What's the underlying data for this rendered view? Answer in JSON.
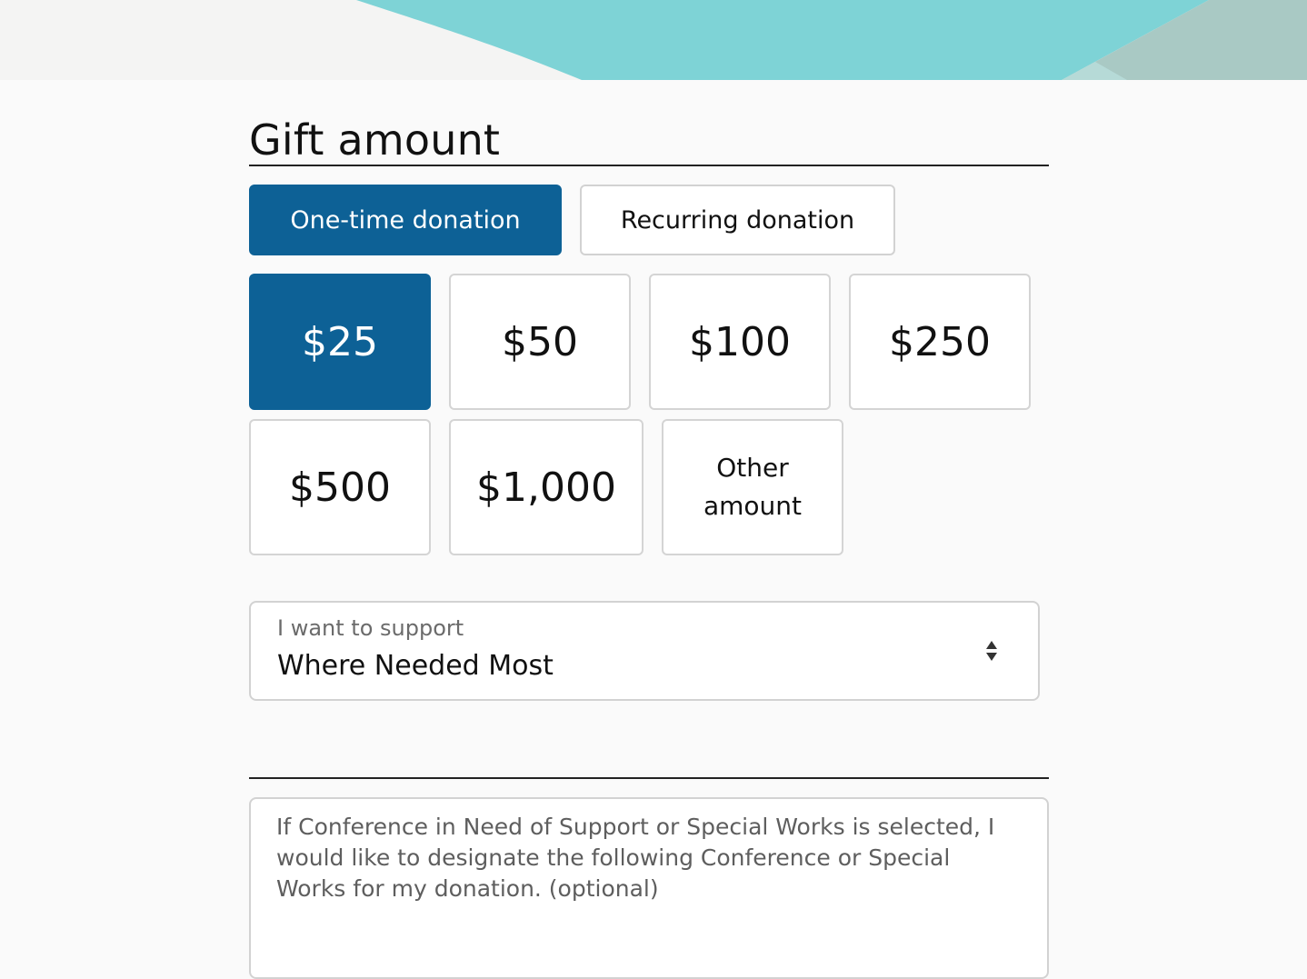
{
  "section": {
    "title": "Gift amount"
  },
  "frequency": {
    "selected": "one_time",
    "one_time_label": "One-time donation",
    "recurring_label": "Recurring donation"
  },
  "amounts": {
    "selected": "$25",
    "options": [
      "$25",
      "$50",
      "$100",
      "$250",
      "$500",
      "$1,000"
    ],
    "other_label": "Other amount"
  },
  "designation": {
    "label": "I want to support",
    "value": "Where Needed Most"
  },
  "note": {
    "placeholder": "If Conference in Need of Support or Special Works is selected, I would like to designate the following Conference or Special Works for my donation. (optional)"
  },
  "colors": {
    "accent": "#0d6196",
    "banner_teal": "#7ed3d6",
    "banner_sage": "#a9c9c4"
  }
}
